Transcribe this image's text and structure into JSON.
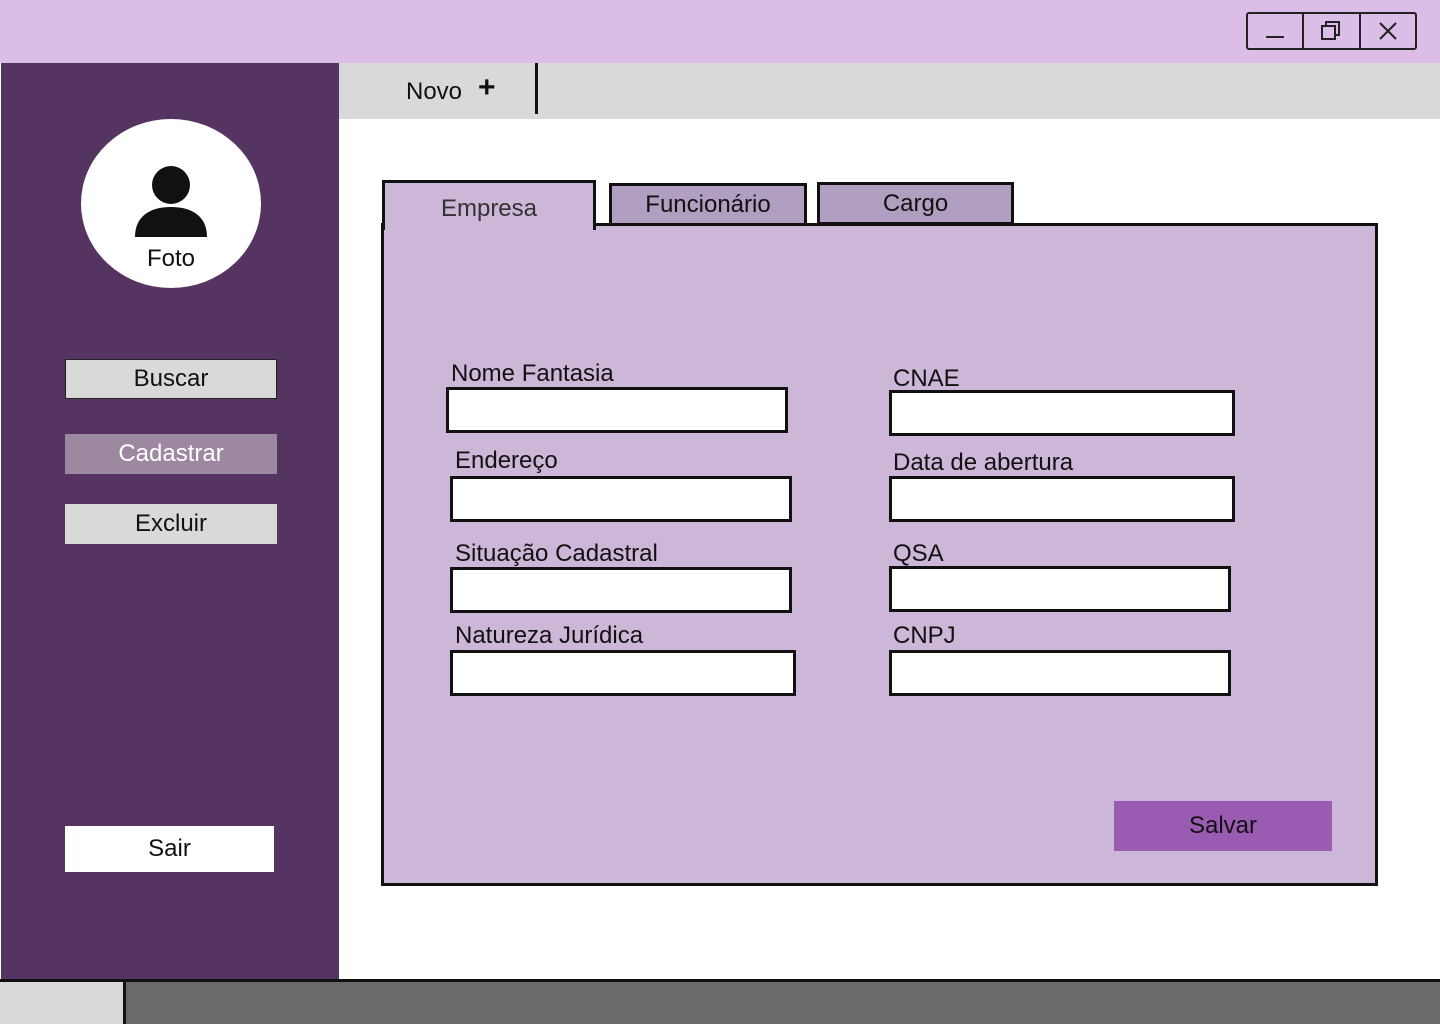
{
  "window": {
    "controls": [
      "minimize-icon",
      "restore-icon",
      "close-icon"
    ]
  },
  "sidebar": {
    "photo_label": "Foto",
    "buttons": {
      "search": "Buscar",
      "register": "Cadastrar",
      "delete": "Excluir",
      "exit": "Sair"
    }
  },
  "tabstrip": {
    "new_tab_label": "Novo",
    "new_tab_icon": "+"
  },
  "form": {
    "tabs": [
      "Empresa",
      "Funcionário",
      "Cargo"
    ],
    "active_tab": "Empresa",
    "fields": {
      "nome_fantasia": {
        "label": "Nome Fantasia",
        "value": ""
      },
      "endereco": {
        "label": "Endereço",
        "value": ""
      },
      "situacao_cadastral": {
        "label": "Situação Cadastral",
        "value": ""
      },
      "natureza_juridica": {
        "label": "Natureza Jurídica",
        "value": ""
      },
      "cnae": {
        "label": "CNAE",
        "value": ""
      },
      "data_abertura": {
        "label": "Data de abertura",
        "value": ""
      },
      "qsa": {
        "label": "QSA",
        "value": ""
      },
      "cnpj": {
        "label": "CNPJ",
        "value": ""
      }
    },
    "save_label": "Salvar"
  },
  "colors": {
    "titlebar": "#dbbde8",
    "sidebar": "#553461",
    "panel": "#cdb7d8",
    "inactive_tab": "#b09fc0",
    "save_button": "#9a5bb2",
    "active_sidebar_button": "#9c889f",
    "statusbar": "#6a6a6a"
  }
}
